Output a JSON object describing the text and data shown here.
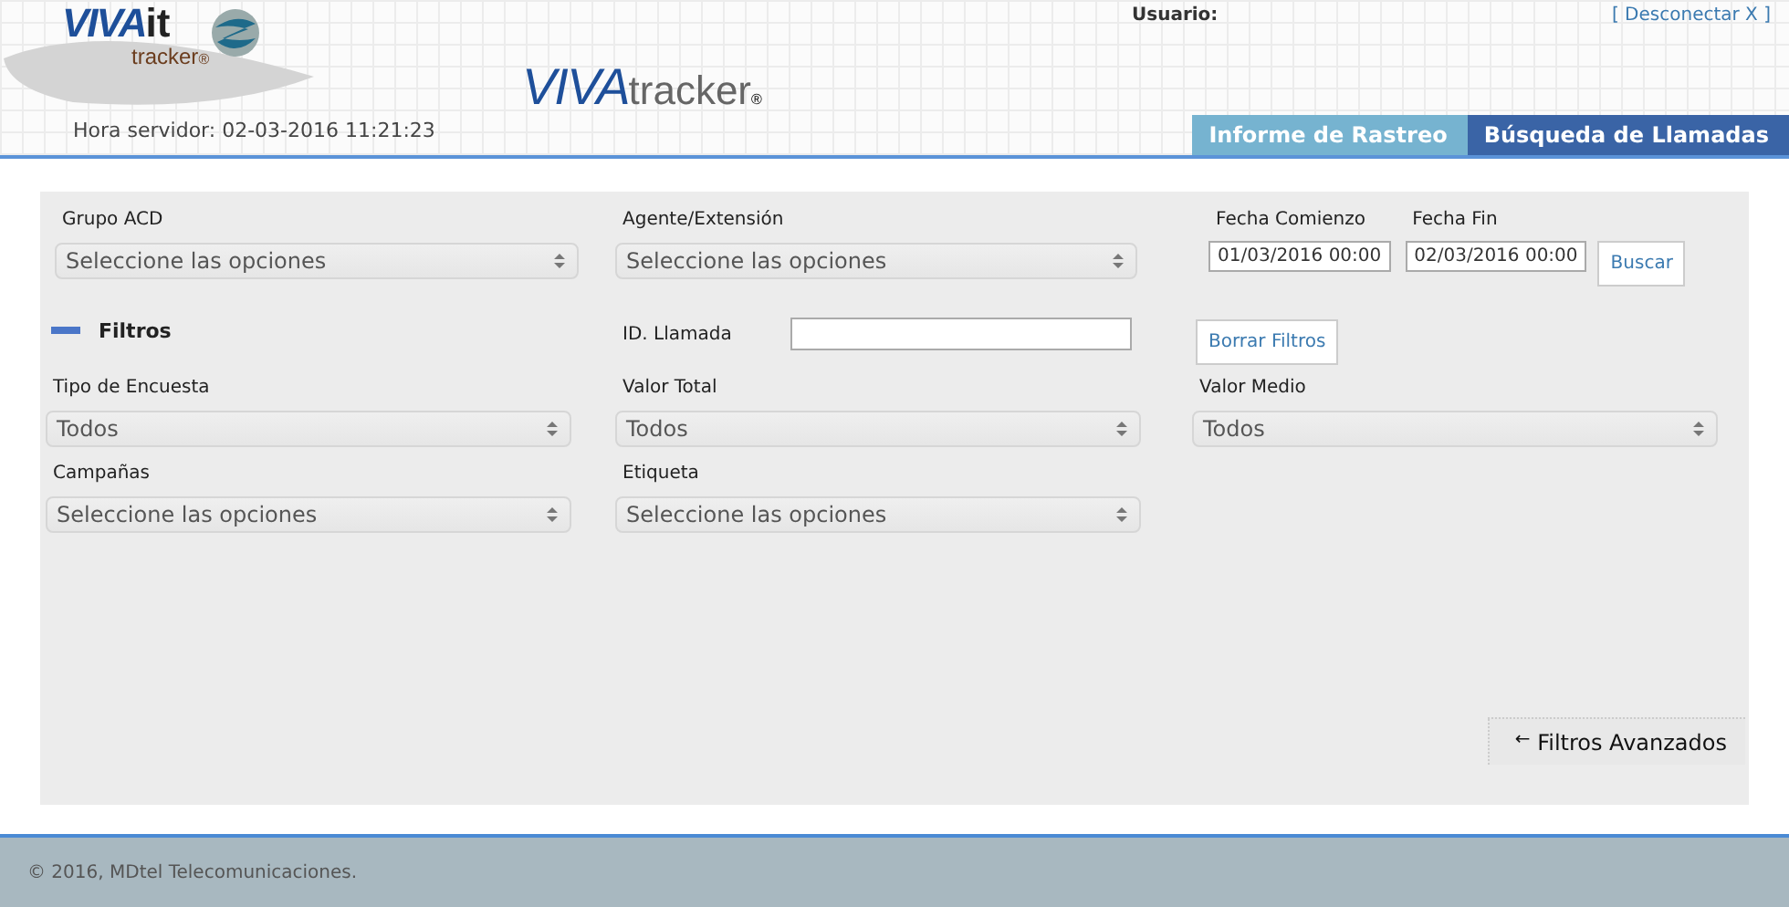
{
  "logo": {
    "brand": "VIVA",
    "suffix": "it",
    "sub": "tracker",
    "mark": "®"
  },
  "product": {
    "brand": "VIVA",
    "name": "tracker",
    "mark": "®"
  },
  "server_time": "Hora servidor: 02-03-2016 11:21:23",
  "user_label": "Usuario:",
  "logout": "[ Desconectar X ]",
  "tabs": [
    {
      "label": "Informe de Rastreo",
      "selected": false
    },
    {
      "label": "Búsqueda de Llamadas",
      "selected": true
    }
  ],
  "grupo_acd": {
    "label": "Grupo ACD",
    "value": "Seleccione las opciones"
  },
  "agente": {
    "label": "Agente/Extensión",
    "value": "Seleccione las opciones"
  },
  "fecha_comienzo": {
    "label": "Fecha Comienzo",
    "value": "01/03/2016 00:00"
  },
  "fecha_fin": {
    "label": "Fecha Fin",
    "value": "02/03/2016 00:00"
  },
  "search_button": "Buscar",
  "filters_toggle": {
    "label": "Filtros",
    "expanded": true
  },
  "id_llamada": {
    "label": "ID. Llamada"
  },
  "clear_button": "Borrar Filtros",
  "tipo_encuesta": {
    "label": "Tipo de Encuesta",
    "value": "Todos"
  },
  "valor_total": {
    "label": "Valor Total",
    "value": "Todos"
  },
  "valor_medio": {
    "label": "Valor Medio",
    "value": "Todos"
  },
  "campanas": {
    "label": "Campañas",
    "value": "Seleccione las opciones"
  },
  "etiqueta": {
    "label": "Etiqueta",
    "value": "Seleccione las opciones"
  },
  "advanced_button": {
    "arrow": "←",
    "label": "Filtros Avanzados"
  },
  "footer": "© 2016, MDtel Telecomunicaciones."
}
